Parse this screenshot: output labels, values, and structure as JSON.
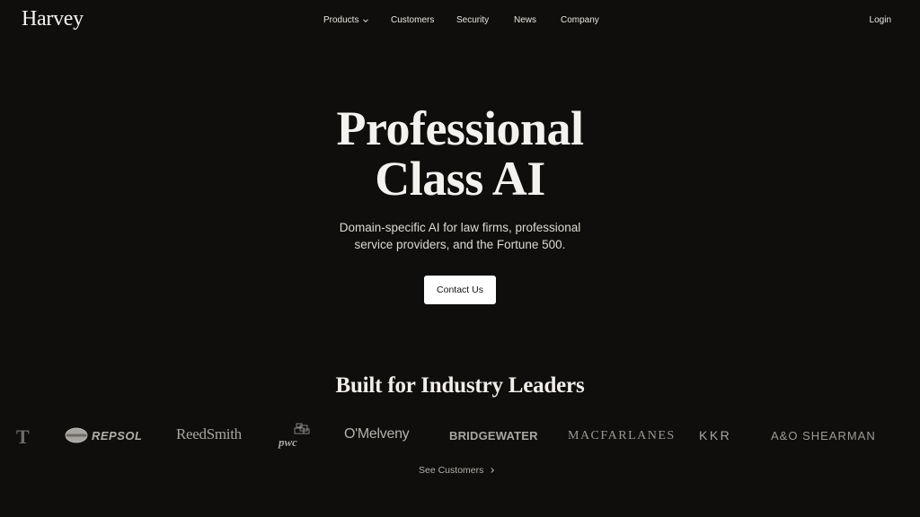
{
  "brand": {
    "name": "Harvey"
  },
  "nav": {
    "items": [
      {
        "label": "Products",
        "has_dropdown": true
      },
      {
        "label": "Customers"
      },
      {
        "label": "Security"
      },
      {
        "label": "News"
      },
      {
        "label": "Company"
      }
    ],
    "login_label": "Login"
  },
  "hero": {
    "title_line1": "Professional",
    "title_line2": "Class AI",
    "subtitle": "Domain-specific AI for law firms, professional service providers, and the Fortune 500.",
    "cta_label": "Contact Us"
  },
  "leaders": {
    "title": "Built for Industry Leaders",
    "logos": [
      "T",
      "REPSOL",
      "ReedSmith",
      "pwc",
      "O'Melveny",
      "BRIDGEWATER",
      "MACFARLANES",
      "KKR",
      "A&O SHEARMAN"
    ],
    "see_customers_label": "See Customers"
  },
  "colors": {
    "background": "#0f0e0d",
    "text": "#f3f1ed",
    "cta_bg": "#ffffff",
    "logo_gray": "#aaa7a2"
  },
  "icons": [
    "chevron-down-icon",
    "chevron-right-icon"
  ]
}
